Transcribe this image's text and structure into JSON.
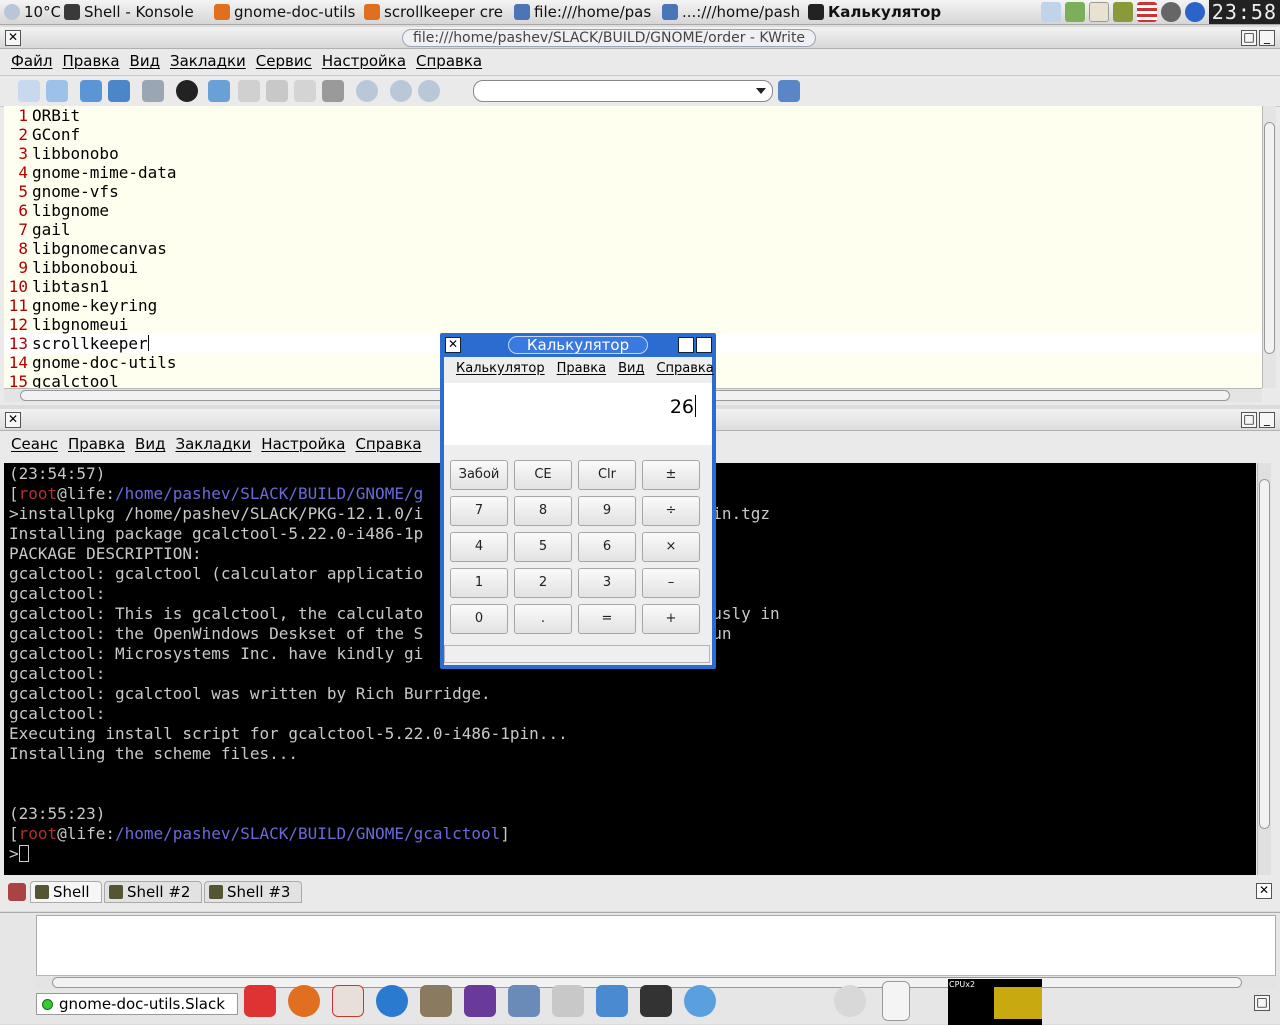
{
  "topbar": {
    "weather": "10°C",
    "tasks": [
      {
        "label": "Shell - Konsole",
        "icon": "konsole-icon",
        "width": 150
      },
      {
        "label": "gnome-doc-utils",
        "icon": "firefox-icon",
        "width": 150
      },
      {
        "label": "scrollkeeper cre",
        "icon": "firefox-icon",
        "width": 150
      },
      {
        "label": "file:///home/pas",
        "icon": "kwrite-icon",
        "width": 148
      },
      {
        "label": "...:///home/pash",
        "icon": "kwrite-icon",
        "width": 146
      },
      {
        "label": "Калькулятор",
        "icon": "calculator-x-icon",
        "width": 150,
        "active": true
      }
    ],
    "clock": "23:58"
  },
  "kwrite": {
    "title": "file:///home/pashev/SLACK/BUILD/GNOME/order - KWrite",
    "menu": [
      "Файл",
      "Правка",
      "Вид",
      "Закладки",
      "Сервис",
      "Настройка",
      "Справка"
    ],
    "search_value": "",
    "lines": [
      {
        "n": "1",
        "text": "ORBit"
      },
      {
        "n": "2",
        "text": "GConf"
      },
      {
        "n": "3",
        "text": "libbonobo"
      },
      {
        "n": "4",
        "text": "gnome-mime-data"
      },
      {
        "n": "5",
        "text": "gnome-vfs"
      },
      {
        "n": "6",
        "text": "libgnome"
      },
      {
        "n": "7",
        "text": "gail"
      },
      {
        "n": "8",
        "text": "libgnomecanvas"
      },
      {
        "n": "9",
        "text": "libbonoboui"
      },
      {
        "n": "10",
        "text": "libtasn1"
      },
      {
        "n": "11",
        "text": "gnome-keyring"
      },
      {
        "n": "12",
        "text": "libgnomeui"
      },
      {
        "n": "13",
        "text": "scrollkeeper",
        "cursor": true
      },
      {
        "n": "14",
        "text": "gnome-doc-utils"
      },
      {
        "n": "15",
        "text": "gcalctool"
      }
    ]
  },
  "konsole": {
    "menu": [
      "Сеанс",
      "Правка",
      "Вид",
      "Закладки",
      "Настройка",
      "Справка"
    ],
    "lines": [
      [
        {
          "t": "(23:54:57)"
        }
      ],
      [
        {
          "t": "["
        },
        {
          "t": "root",
          "c": "root"
        },
        {
          "t": "@life:"
        },
        {
          "t": "/home/pashev/SLACK/BUILD/GNOME/g",
          "c": "path"
        }
      ],
      [
        {
          "t": ">installpkg /home/pashev/SLACK/PKG-12.1.0/i                             pin.tgz"
        }
      ],
      [
        {
          "t": "Installing package gcalctool-5.22.0-i486-1p"
        }
      ],
      [
        {
          "t": "PACKAGE DESCRIPTION:"
        }
      ],
      [
        {
          "t": "gcalctool: gcalctool (calculator applicatio"
        }
      ],
      [
        {
          "t": "gcalctool:"
        }
      ],
      [
        {
          "t": "gcalctool: This is gcalctool, the calculato                             ously in"
        }
      ],
      [
        {
          "t": "gcalctool: the OpenWindows Deskset of the S                             Sun"
        }
      ],
      [
        {
          "t": "gcalctool: Microsystems Inc. have kindly gi                             ."
        }
      ],
      [
        {
          "t": "gcalctool:"
        }
      ],
      [
        {
          "t": "gcalctool: gcalctool was written by Rich Burridge."
        }
      ],
      [
        {
          "t": "gcalctool:"
        }
      ],
      [
        {
          "t": "Executing install script for gcalctool-5.22.0-i486-1pin..."
        }
      ],
      [
        {
          "t": "Installing the scheme files..."
        }
      ],
      [
        {
          "t": ""
        }
      ],
      [
        {
          "t": ""
        }
      ],
      [
        {
          "t": "(23:55:23)"
        }
      ],
      [
        {
          "t": "["
        },
        {
          "t": "root",
          "c": "root"
        },
        {
          "t": "@life:"
        },
        {
          "t": "/home/pashev/SLACK/BUILD/GNOME/gcalctool",
          "c": "path"
        },
        {
          "t": "]"
        }
      ],
      [
        {
          "t": ">"
        },
        {
          "cursor": true
        }
      ]
    ],
    "tabs": [
      {
        "label": "Shell",
        "active": true,
        "width": 72
      },
      {
        "label": "Shell #2",
        "active": false,
        "width": 98
      },
      {
        "label": "Shell #3",
        "active": false,
        "width": 98
      }
    ]
  },
  "calculator": {
    "title": "Калькулятор",
    "menu": [
      "Калькулятор",
      "Правка",
      "Вид",
      "Справка"
    ],
    "display": "26",
    "keys": [
      [
        "Забой",
        "CE",
        "Clr",
        "±"
      ],
      [
        "7",
        "8",
        "9",
        "÷"
      ],
      [
        "4",
        "5",
        "6",
        "×"
      ],
      [
        "1",
        "2",
        "3",
        "–"
      ],
      [
        "0",
        ".",
        "=",
        "+"
      ]
    ]
  },
  "panel": {
    "task_label": "gnome-doc-utils.Slack",
    "cpu_label": "CPUx2"
  },
  "colors": {
    "editor_bg": "#fffff0",
    "line_number": "#b00000",
    "term_root": "#b03030",
    "term_path": "#6a6ad8",
    "calc_frame": "#2a6ccf"
  }
}
